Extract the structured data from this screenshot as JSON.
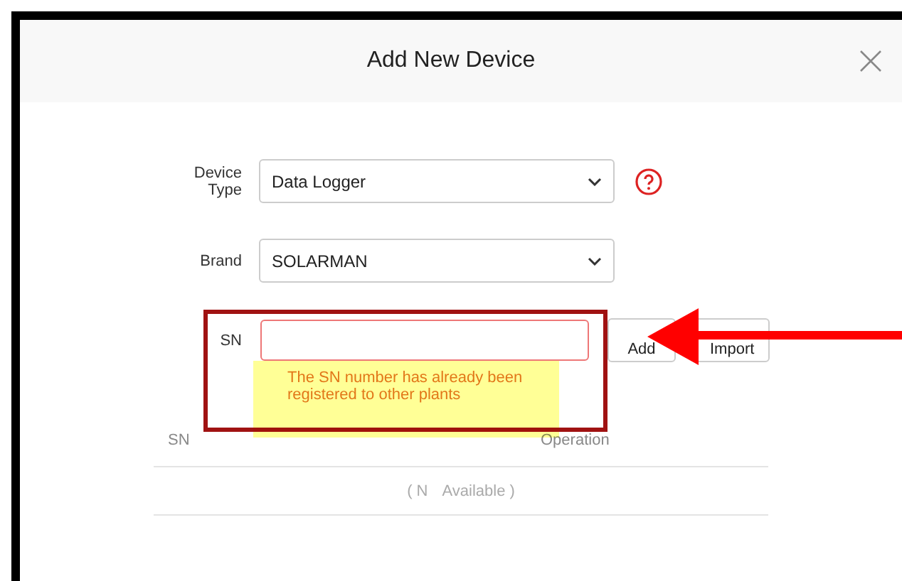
{
  "dialog": {
    "title": "Add New Device"
  },
  "fields": [
    {
      "kind": "select",
      "label": "Device Type",
      "value": "Data Logger",
      "help": true
    },
    {
      "kind": "select",
      "label": "Brand",
      "value": "SOLARMAN",
      "help": false
    },
    {
      "kind": "input",
      "label": "SN",
      "error": true,
      "buttons": [
        "Add",
        "Import"
      ],
      "message": "The SN number has already been registered to other plants"
    }
  ],
  "table": {
    "columns": [
      "SN",
      "Operation"
    ],
    "empty_text": [
      "( N",
      "Available )"
    ]
  },
  "annotations": [
    {
      "kind": "box"
    },
    {
      "kind": "highlight"
    },
    {
      "kind": "arrow"
    }
  ]
}
